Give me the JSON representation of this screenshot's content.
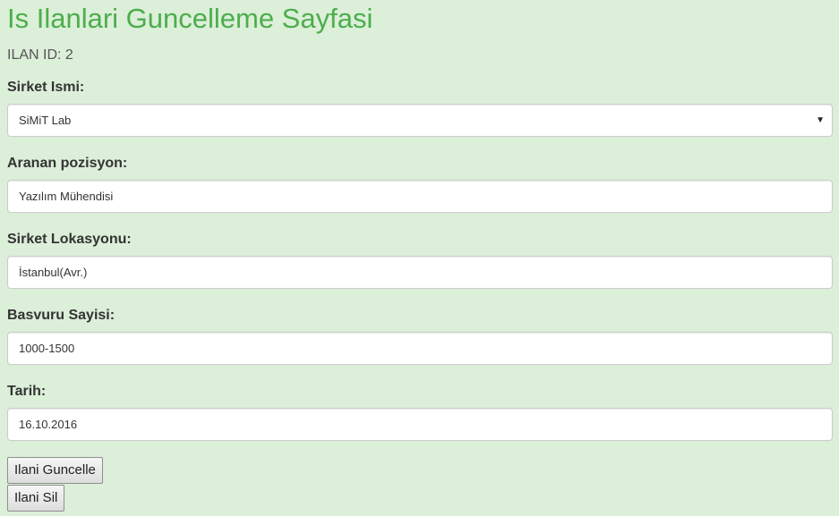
{
  "page": {
    "title": "Is Ilanlari Guncelleme Sayfasi",
    "ilan_id_label": "ILAN ID:",
    "ilan_id_value": "2"
  },
  "form": {
    "company": {
      "label": "Sirket Ismi:",
      "selected": "SiMiT Lab"
    },
    "position": {
      "label": "Aranan pozisyon:",
      "value": "Yazılım Mühendisi"
    },
    "location": {
      "label": "Sirket Lokasyonu:",
      "value": "İstanbul(Avr.)"
    },
    "applications": {
      "label": "Basvuru Sayisi:",
      "value": "1000-1500"
    },
    "date": {
      "label": "Tarih:",
      "value": "16.10.2016"
    }
  },
  "buttons": {
    "update": "Ilani Guncelle",
    "delete": "Ilani Sil"
  },
  "colors": {
    "background": "#dcefd9",
    "title": "#4cae4c"
  },
  "icons": {
    "select_caret": "caret-down-icon"
  }
}
